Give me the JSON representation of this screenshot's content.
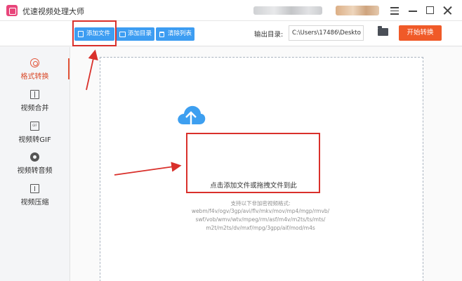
{
  "window": {
    "title": "优速视频处理大师"
  },
  "toolbar": {
    "add_file_label": "添加文件",
    "add_dir_label": "添加目录",
    "clear_list_label": "清除列表",
    "output_label": "输出目录:",
    "output_path": "C:\\Users\\17486\\Deskto",
    "start_label": "开始转换"
  },
  "sidebar": {
    "items": [
      {
        "label": "格式转换",
        "icon": "format-convert-icon",
        "active": true
      },
      {
        "label": "视频合并",
        "icon": "merge-icon",
        "active": false
      },
      {
        "label": "视频转GIF",
        "icon": "gif-icon",
        "active": false
      },
      {
        "label": "视频转音频",
        "icon": "audio-icon",
        "active": false
      },
      {
        "label": "视频压缩",
        "icon": "compress-icon",
        "active": false
      }
    ]
  },
  "dropzone": {
    "prompt": "点击添加文件或拖拽文件到此",
    "formats_heading": "支持以下非加密视频格式:",
    "formats_lines": [
      "webm/f4v/ogv/3gp/avi/flv/mkv/mov/mp4/mgp/rmvb/",
      "swf/vob/wmv/wtv/mpeg/rm/asf/m4v/m2ts/ts/mts/",
      "m2t/m2ts/dv/mxf/mpg/3gpp/aif/mod/m4s"
    ]
  },
  "colors": {
    "accent_blue": "#3d9df2",
    "start_orange": "#f05a28",
    "active_red": "#e2553a",
    "annotation_red": "#d9302b"
  }
}
